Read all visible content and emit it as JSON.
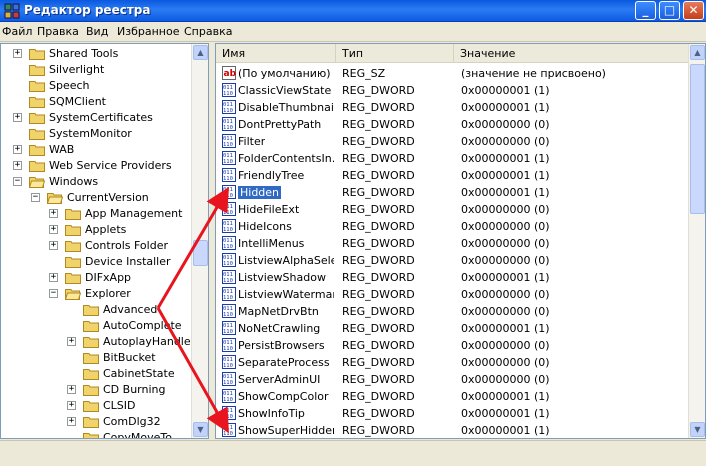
{
  "window": {
    "title": "Редактор реестра",
    "buttons": {
      "minimize": "_",
      "maximize": "□",
      "close": "✕"
    }
  },
  "menu": [
    "Файл",
    "Правка",
    "Вид",
    "Избранное",
    "Справка"
  ],
  "tree": [
    {
      "label": "Shared Tools",
      "level": 1,
      "expander": "+"
    },
    {
      "label": "Silverlight",
      "level": 1,
      "expander": ""
    },
    {
      "label": "Speech",
      "level": 1,
      "expander": ""
    },
    {
      "label": "SQMClient",
      "level": 1,
      "expander": ""
    },
    {
      "label": "SystemCertificates",
      "level": 1,
      "expander": "+"
    },
    {
      "label": "SystemMonitor",
      "level": 1,
      "expander": ""
    },
    {
      "label": "WAB",
      "level": 1,
      "expander": "+"
    },
    {
      "label": "Web Service Providers",
      "level": 1,
      "expander": "+"
    },
    {
      "label": "Windows",
      "level": 1,
      "expander": "−"
    },
    {
      "label": "CurrentVersion",
      "level": 2,
      "expander": "−"
    },
    {
      "label": "App Management",
      "level": 3,
      "expander": "+"
    },
    {
      "label": "Applets",
      "level": 3,
      "expander": "+"
    },
    {
      "label": "Controls Folder",
      "level": 3,
      "expander": "+"
    },
    {
      "label": "Device Installer",
      "level": 3,
      "expander": ""
    },
    {
      "label": "DIFxApp",
      "level": 3,
      "expander": "+"
    },
    {
      "label": "Explorer",
      "level": 3,
      "expander": "−"
    },
    {
      "label": "Advanced",
      "level": 4,
      "expander": ""
    },
    {
      "label": "AutoComplete",
      "level": 4,
      "expander": ""
    },
    {
      "label": "AutoplayHandlers",
      "level": 4,
      "expander": "+"
    },
    {
      "label": "BitBucket",
      "level": 4,
      "expander": ""
    },
    {
      "label": "CabinetState",
      "level": 4,
      "expander": ""
    },
    {
      "label": "CD Burning",
      "level": 4,
      "expander": "+"
    },
    {
      "label": "CLSID",
      "level": 4,
      "expander": "+"
    },
    {
      "label": "ComDlg32",
      "level": 4,
      "expander": "+"
    },
    {
      "label": "CopyMoveTo",
      "level": 4,
      "expander": ""
    }
  ],
  "list": {
    "columns": [
      "Имя",
      "Тип",
      "Значение"
    ],
    "rows": [
      {
        "name": "(По умолчанию)",
        "type": "REG_SZ",
        "value": "(значение не присвоено)",
        "icon": "ab"
      },
      {
        "name": "ClassicViewState",
        "type": "REG_DWORD",
        "value": "0x00000001 (1)",
        "icon": "bin"
      },
      {
        "name": "DisableThumbnail...",
        "type": "REG_DWORD",
        "value": "0x00000001 (1)",
        "icon": "bin"
      },
      {
        "name": "DontPrettyPath",
        "type": "REG_DWORD",
        "value": "0x00000000 (0)",
        "icon": "bin"
      },
      {
        "name": "Filter",
        "type": "REG_DWORD",
        "value": "0x00000000 (0)",
        "icon": "bin"
      },
      {
        "name": "FolderContentsIn...",
        "type": "REG_DWORD",
        "value": "0x00000001 (1)",
        "icon": "bin"
      },
      {
        "name": "FriendlyTree",
        "type": "REG_DWORD",
        "value": "0x00000001 (1)",
        "icon": "bin"
      },
      {
        "name": "Hidden",
        "type": "REG_DWORD",
        "value": "0x00000001 (1)",
        "icon": "bin",
        "selected": true
      },
      {
        "name": "HideFileExt",
        "type": "REG_DWORD",
        "value": "0x00000000 (0)",
        "icon": "bin"
      },
      {
        "name": "HideIcons",
        "type": "REG_DWORD",
        "value": "0x00000000 (0)",
        "icon": "bin"
      },
      {
        "name": "IntelliMenus",
        "type": "REG_DWORD",
        "value": "0x00000000 (0)",
        "icon": "bin"
      },
      {
        "name": "ListviewAlphaSelect",
        "type": "REG_DWORD",
        "value": "0x00000000 (0)",
        "icon": "bin"
      },
      {
        "name": "ListviewShadow",
        "type": "REG_DWORD",
        "value": "0x00000001 (1)",
        "icon": "bin"
      },
      {
        "name": "ListviewWatermark",
        "type": "REG_DWORD",
        "value": "0x00000000 (0)",
        "icon": "bin"
      },
      {
        "name": "MapNetDrvBtn",
        "type": "REG_DWORD",
        "value": "0x00000000 (0)",
        "icon": "bin"
      },
      {
        "name": "NoNetCrawling",
        "type": "REG_DWORD",
        "value": "0x00000001 (1)",
        "icon": "bin"
      },
      {
        "name": "PersistBrowsers",
        "type": "REG_DWORD",
        "value": "0x00000000 (0)",
        "icon": "bin"
      },
      {
        "name": "SeparateProcess",
        "type": "REG_DWORD",
        "value": "0x00000000 (0)",
        "icon": "bin"
      },
      {
        "name": "ServerAdminUI",
        "type": "REG_DWORD",
        "value": "0x00000000 (0)",
        "icon": "bin"
      },
      {
        "name": "ShowCompColor",
        "type": "REG_DWORD",
        "value": "0x00000001 (1)",
        "icon": "bin"
      },
      {
        "name": "ShowInfoTip",
        "type": "REG_DWORD",
        "value": "0x00000001 (1)",
        "icon": "bin"
      },
      {
        "name": "ShowSuperHidden",
        "type": "REG_DWORD",
        "value": "0x00000001 (1)",
        "icon": "bin"
      }
    ]
  },
  "icons": {
    "folder": "folder-icon",
    "string_value": "string-value-icon",
    "dword_value": "dword-value-icon",
    "app": "registry-editor-icon"
  },
  "colors": {
    "selection": "#316ac5",
    "annotation_arrow": "#e8141e",
    "folder": "#f1d36c"
  }
}
